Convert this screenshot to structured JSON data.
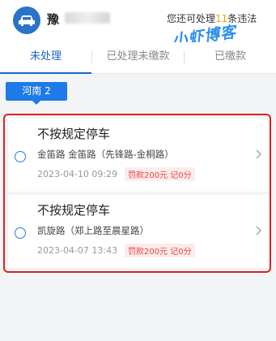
{
  "header": {
    "plate_prefix": "豫",
    "notice_prefix": "您还可处理",
    "notice_count": "11",
    "notice_suffix": "条违法",
    "watermark": "小虾博客"
  },
  "tabs": [
    {
      "label": "未处理",
      "active": true
    },
    {
      "label": "已处理未缴款",
      "active": false
    },
    {
      "label": "已缴款",
      "active": false
    }
  ],
  "region_tag": "河南 2",
  "violations": [
    {
      "title": "不按规定停车",
      "location": "金笛路 金笛路（先锋路-金桐路）",
      "time": "2023-04-10 09:29",
      "penalty": "罚款200元 记0分"
    },
    {
      "title": "不按规定停车",
      "location": "凯旋路（郑上路至晨星路）",
      "time": "2023-04-07 13:43",
      "penalty": "罚款200元 记0分"
    }
  ],
  "colors": {
    "accent": "#1a66c8",
    "tag": "#1d7ae8",
    "penalty": "#e84545",
    "highlight_border": "#e02020"
  }
}
